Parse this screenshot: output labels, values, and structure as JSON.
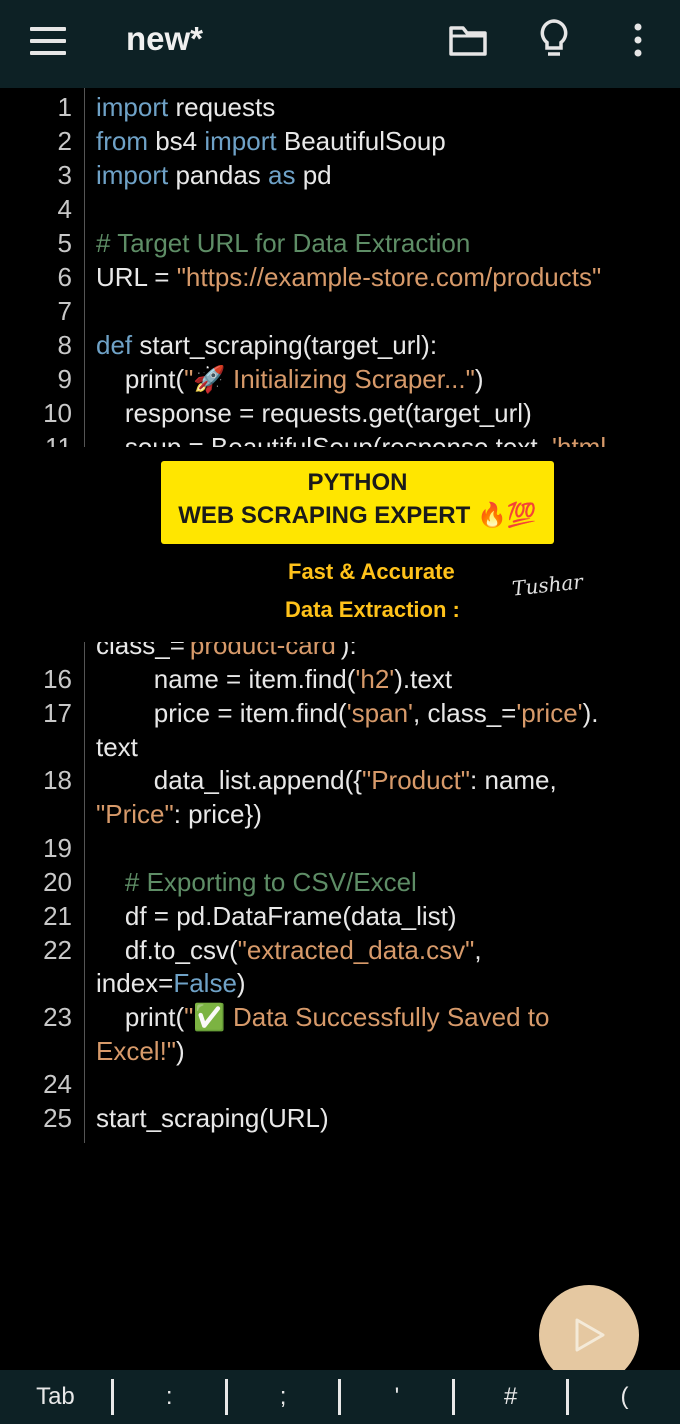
{
  "header": {
    "title": "new*"
  },
  "icons": {
    "menu": "menu-icon",
    "folder": "folder-icon",
    "bulb": "lightbulb-icon",
    "more": "more-vertical-icon",
    "run": "play-icon"
  },
  "code_lines": [
    {
      "n": "1",
      "parts": [
        [
          "kw",
          "import"
        ],
        [
          "pl",
          " requests"
        ]
      ]
    },
    {
      "n": "2",
      "parts": [
        [
          "kw",
          "from"
        ],
        [
          "pl",
          " bs4 "
        ],
        [
          "kw",
          "import"
        ],
        [
          "pl",
          " BeautifulSoup"
        ]
      ]
    },
    {
      "n": "3",
      "parts": [
        [
          "kw",
          "import"
        ],
        [
          "pl",
          " pandas "
        ],
        [
          "kw",
          "as"
        ],
        [
          "pl",
          " pd"
        ]
      ]
    },
    {
      "n": "4",
      "parts": []
    },
    {
      "n": "5",
      "parts": [
        [
          "cm",
          "# Target URL for Data Extraction"
        ]
      ]
    },
    {
      "n": "6",
      "parts": [
        [
          "pl",
          "URL = "
        ],
        [
          "str",
          "\"https://example-store.com/products\""
        ]
      ]
    },
    {
      "n": "7",
      "parts": []
    },
    {
      "n": "8",
      "parts": [
        [
          "kw",
          "def"
        ],
        [
          "pl",
          " start_scraping(target_url):"
        ]
      ]
    },
    {
      "n": "9",
      "parts": [
        [
          "pl",
          "    print("
        ],
        [
          "str",
          "\"🚀 Initializing Scraper...\""
        ],
        [
          "pl",
          ")"
        ]
      ]
    },
    {
      "n": "10",
      "parts": [
        [
          "pl",
          "    response = requests.get(target_url)"
        ]
      ]
    },
    {
      "n": "11",
      "parts": [
        [
          "pl",
          "    soup = BeautifulSoup(response.text, "
        ],
        [
          "str",
          "'html"
        ]
      ]
    },
    {
      "n": "",
      "parts": [
        [
          "pl",
          "class_="
        ],
        [
          "str",
          "'product-card'"
        ],
        [
          "pl",
          "):"
        ]
      ]
    },
    {
      "n": "16",
      "parts": [
        [
          "pl",
          "        name = item.find("
        ],
        [
          "str",
          "'h2'"
        ],
        [
          "pl",
          ").text"
        ]
      ]
    },
    {
      "n": "17",
      "parts": [
        [
          "pl",
          "        price = item.find("
        ],
        [
          "str",
          "'span'"
        ],
        [
          "pl",
          ", class_="
        ],
        [
          "str",
          "'price'"
        ],
        [
          "pl",
          ")."
        ]
      ]
    },
    {
      "n": "",
      "parts": [
        [
          "pl",
          "text"
        ]
      ]
    },
    {
      "n": "18",
      "parts": [
        [
          "pl",
          "        data_list.append({"
        ],
        [
          "str",
          "\"Product\""
        ],
        [
          "pl",
          ": name,"
        ]
      ]
    },
    {
      "n": "",
      "parts": [
        [
          "str",
          "\"Price\""
        ],
        [
          "pl",
          ": price})"
        ]
      ]
    },
    {
      "n": "19",
      "parts": []
    },
    {
      "n": "20",
      "parts": [
        [
          "cm",
          "    # Exporting to CSV/Excel"
        ]
      ]
    },
    {
      "n": "21",
      "parts": [
        [
          "pl",
          "    df = pd.DataFrame(data_list)"
        ]
      ]
    },
    {
      "n": "22",
      "parts": [
        [
          "pl",
          "    df.to_csv("
        ],
        [
          "str",
          "\"extracted_data.csv\""
        ],
        [
          "pl",
          ","
        ]
      ]
    },
    {
      "n": "",
      "parts": [
        [
          "pl",
          "index="
        ],
        [
          "kw",
          "False"
        ],
        [
          "pl",
          ")"
        ]
      ]
    },
    {
      "n": "23",
      "parts": [
        [
          "pl",
          "    print("
        ],
        [
          "str",
          "\"✅ Data Successfully Saved to"
        ]
      ]
    },
    {
      "n": "",
      "parts": [
        [
          "str",
          "Excel!\""
        ],
        [
          "pl",
          ")"
        ]
      ]
    },
    {
      "n": "24",
      "parts": []
    },
    {
      "n": "25",
      "parts": [
        [
          "pl",
          "start_scraping(URL)"
        ]
      ]
    }
  ],
  "overlay": {
    "banner_line1": "PYTHON",
    "banner_line2": "WEB SCRAPING EXPERT 🔥💯",
    "tagline1": "Fast & Accurate",
    "tagline2": "Data Extraction :",
    "signature": "Tushar"
  },
  "bottom_keys": [
    "Tab",
    ":",
    ";",
    "'",
    "#",
    "("
  ]
}
